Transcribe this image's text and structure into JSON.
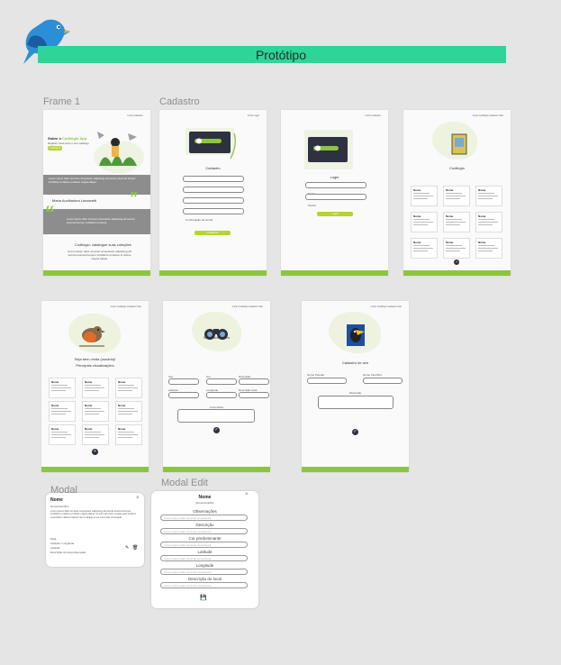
{
  "title": "Protótipo",
  "frames": {
    "frame1": {
      "label": "Frame 1",
      "nav": "Início   Cadastro",
      "hero_title": "Sobre o",
      "hero_highlight": "Codilógio App",
      "hero_sub": "Registre suas aves e seu catálogo",
      "hero_btn": "Cadastrar",
      "band_text": "Lorem ipsum dolor sit amet consectetur adipiscing elit sed do eiusmod tempor incididunt ut labore et dolore magna aliqua.",
      "quote_text": "Maria Auxiliadora Lazzaretti",
      "quote_body": "Lorem ipsum dolor sit amet consectetur adipiscing elit sed do eiusmod tempor incididunt ut labore.",
      "section_title": "Codilógio: catalogue suas coleções",
      "section_body": "Lorem ipsum dolor sit amet consectetur adipiscing elit sed do eiusmod tempor incididunt ut labore et dolore magna aliqua."
    },
    "cadastro": {
      "label": "Cadastro",
      "title": "Cadastro",
      "fields": [
        "Nome",
        "Email",
        "Senha",
        "Confirmação de senha"
      ],
      "btn": "Cadastrar"
    },
    "login": {
      "title": "Login",
      "fields": [
        "Email",
        "Senha"
      ],
      "btn": "Login",
      "nav": "Início   Cadastro"
    },
    "catalogo": {
      "title": "Codilógio",
      "nav": "Início   Codilógio   Cadastro   Sair",
      "card_title": "Nome"
    },
    "home": {
      "heading": "Seja bem-vinda (usuário)!",
      "sub": "Principais visualizações",
      "nav": "Início   Codilógio   Cadastro   Sair",
      "card_title": "Nome"
    },
    "nova": {
      "title": "Nova avistagem",
      "fields": [
        "Ave",
        "Cor",
        "Descrição",
        "Latitude",
        "Longitude",
        "Descrição local"
      ],
      "comment": "Comentário",
      "nav": "Início   Codilógio   Cadastro   Sair"
    },
    "cadastro_ave": {
      "title": "Cadastro de ave",
      "fields": [
        "Nome Popular",
        "Nome Científico"
      ],
      "desc": "Descrição",
      "nav": "Início   Codilógio   Cadastro   Sair"
    }
  },
  "modal": {
    "label": "Modal",
    "name": "Nome",
    "sci": "NomeCientífico",
    "body": "Lorem ipsum dolor sit amet consectetur adipiscing elit sed do eiusmod tempor incididunt ut labore et dolore magna aliqua. Ut enim ad minim veniam quis nostrud exercitation ullamco laboris nisi ut aliquip ex ea commodo consequat.",
    "items": [
      "Data",
      "Latitude / Longitude",
      "Latitude",
      "Descrição do local observado"
    ]
  },
  "modal_edit": {
    "label": "Modal Edit",
    "name": "Nome",
    "sci": "NomeCientífico",
    "fields": [
      "Observações",
      "Descrição",
      "Cor predominante",
      "Latitude",
      "Longitude",
      "Descrição do local"
    ],
    "placeholder": "Lorem ipsum dolor sit amet consectetur"
  },
  "colors": {
    "accent": "#2ed598",
    "footer": "#8cc63f",
    "button": "#b5d334",
    "dark": "#2e3140"
  }
}
